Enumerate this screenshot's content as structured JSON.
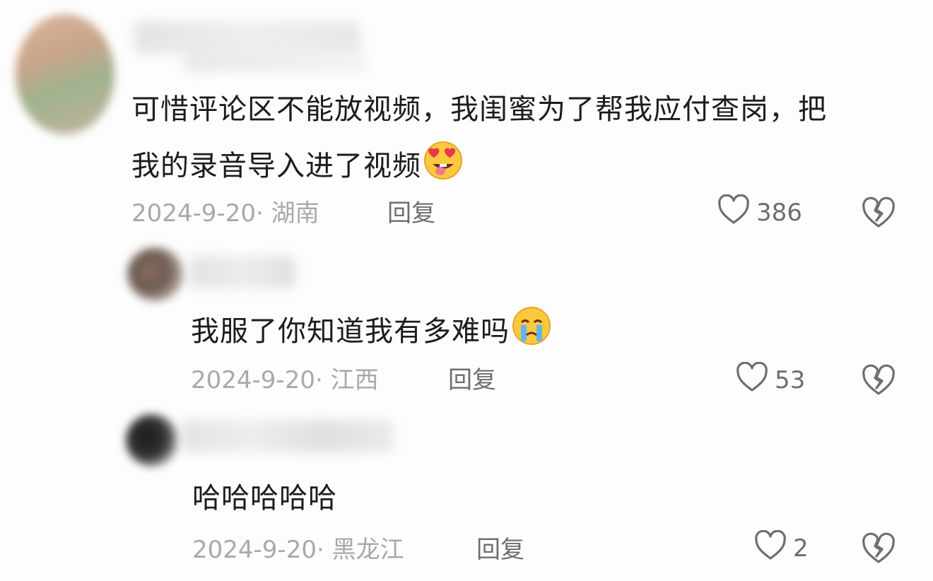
{
  "comments": [
    {
      "text_line1": "可惜评论区不能放视频，我闺蜜为了帮我应付查岗，把",
      "text_line2": "我的录音导入进了视频",
      "emoji": "star-struck-tongue-emoji",
      "date": "2024-9-20",
      "location": "· 湖南",
      "reply_label": "回复",
      "likes": "386",
      "icon_like": "heart-outline-icon",
      "icon_dislike": "broken-heart-icon"
    },
    {
      "text": "我服了你知道我有多难吗",
      "emoji": "crying-face-emoji",
      "date": "2024-9-20",
      "location": "· 江西",
      "reply_label": "回复",
      "likes": "53",
      "icon_like": "heart-outline-icon",
      "icon_dislike": "broken-heart-icon"
    },
    {
      "text": "哈哈哈哈哈",
      "date": "2024-9-20",
      "location": "· 黑龙江",
      "reply_label": "回复",
      "likes": "2",
      "icon_like": "heart-outline-icon",
      "icon_dislike": "broken-heart-icon"
    }
  ],
  "colors": {
    "text": "#1c1c1c",
    "meta": "#a9a9a9",
    "action": "#6e6e6e",
    "background": "#fdfdfd"
  }
}
